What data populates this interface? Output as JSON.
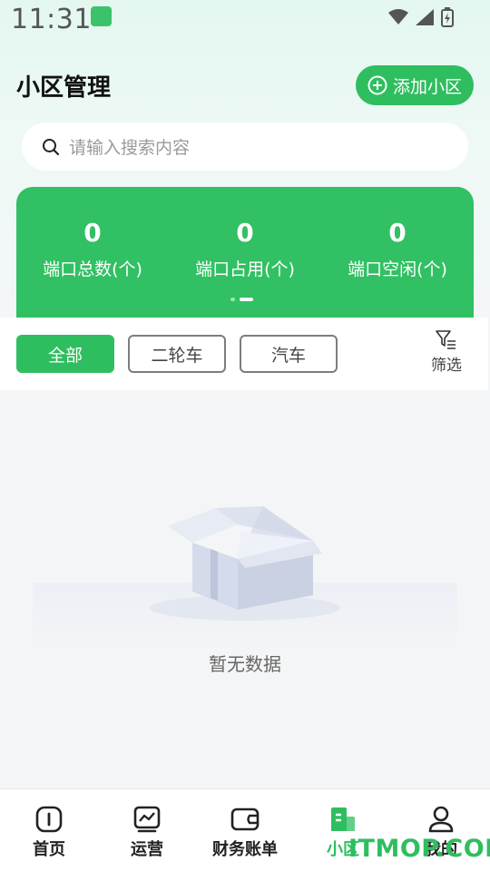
{
  "status_bar": {
    "time": "11:31"
  },
  "header": {
    "title": "小区管理",
    "add_button_label": "添加小区"
  },
  "search": {
    "placeholder": "请输入搜索内容"
  },
  "stats": [
    {
      "value": "0",
      "label": "端口总数(个)"
    },
    {
      "value": "0",
      "label": "端口占用(个)"
    },
    {
      "value": "0",
      "label": "端口空闲(个)"
    }
  ],
  "filters": {
    "chips": [
      "全部",
      "二轮车",
      "汽车"
    ],
    "selected": "全部",
    "filter_label": "筛选"
  },
  "empty_state": {
    "text": "暂无数据"
  },
  "tabbar": {
    "items": [
      {
        "label": "首页",
        "icon": "info-icon"
      },
      {
        "label": "运营",
        "icon": "chart-icon"
      },
      {
        "label": "财务账单",
        "icon": "wallet-icon"
      },
      {
        "label": "小区",
        "icon": "building-icon"
      },
      {
        "label": "我的",
        "icon": "user-icon"
      }
    ],
    "active": "小区"
  },
  "watermark": {
    "text": "ITMOP.COM"
  },
  "colors": {
    "accent": "#2fbe5f",
    "card": "#31c063"
  }
}
